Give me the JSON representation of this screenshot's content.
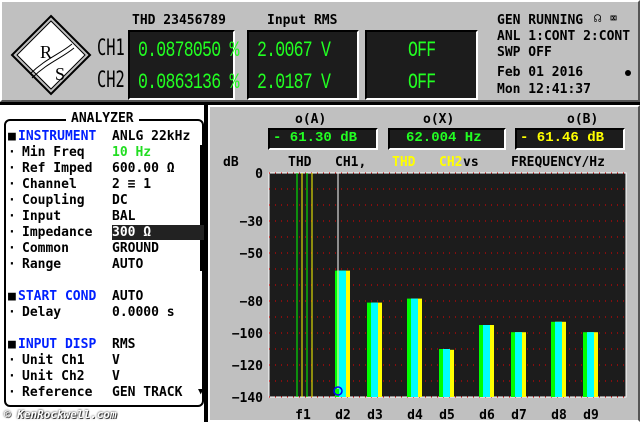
{
  "header": {
    "thd_title": "THD 23456789",
    "rms_title": "Input RMS",
    "ch1_label": "CH1",
    "ch2_label": "CH2",
    "thd_ch1": "0.0878050 %",
    "thd_ch2": "0.0863136 %",
    "rms_ch1": "2.0067  V",
    "rms_ch2": "2.0187  V",
    "third_ch1": "OFF",
    "third_ch2": "OFF",
    "status": {
      "gen": "GEN RUNNING",
      "anl": "ANL 1:CONT 2:CONT",
      "swp": "SWP OFF",
      "date": "Feb 01 2016",
      "time": "Mon 12:41:37"
    },
    "icons": [
      "headphones-muted-icon",
      "speaker-muted-icon",
      "lamp-icon"
    ]
  },
  "analyzer": {
    "title": "ANALYZER",
    "rows": [
      {
        "key": "INSTRUMENT",
        "value": "ANLG  22kHz",
        "section": true
      },
      {
        "key": "Min Freq",
        "value": "10 Hz"
      },
      {
        "key": "Ref Imped",
        "value": "600.00 Ω"
      },
      {
        "key": "Channel",
        "value": "2 ≡ 1"
      },
      {
        "key": "Coupling",
        "value": "DC"
      },
      {
        "key": "Input",
        "value": "BAL"
      },
      {
        "key": "Impedance",
        "value": "300 Ω",
        "selected": true
      },
      {
        "key": "Common",
        "value": "GROUND"
      },
      {
        "key": "Range",
        "value": "AUTO"
      },
      {
        "key": "START COND",
        "value": "AUTO",
        "section": true
      },
      {
        "key": "Delay",
        "value": "0.0000 s"
      },
      {
        "key": "INPUT DISP",
        "value": "RMS",
        "section": true
      },
      {
        "key": "Unit Ch1",
        "value": "V"
      },
      {
        "key": "Unit Ch2",
        "value": "V"
      },
      {
        "key": "Reference",
        "value": "GEN TRACK"
      }
    ],
    "watermark": "© KenRockwell.com"
  },
  "markers": {
    "a_label": "o(A)",
    "a_value": "- 61.30 dB",
    "x_label": "o(X)",
    "x_value": "62.004  Hz",
    "b_label": "o(B)",
    "b_value": "- 61.46 dB"
  },
  "chart_data": {
    "type": "bar",
    "ylabel": "dB",
    "title_parts": [
      "THD",
      "CH1,",
      "THD",
      "CH2",
      "vs",
      "FREQUENCY/Hz"
    ],
    "categories": [
      "f1",
      "d2",
      "d3",
      "d4",
      "d5",
      "d6",
      "d7",
      "d8",
      "d9"
    ],
    "series": [
      {
        "name": "THD CH1",
        "color": "#00ff00",
        "values": [
          0,
          -61,
          -81,
          -78.5,
          -110,
          -95,
          -99.5,
          -93,
          -99.5
        ]
      },
      {
        "name": "THD CH2",
        "color": "#ffff00",
        "values": [
          0,
          -61,
          -81,
          -78.5,
          -110.5,
          -95,
          -99.5,
          -93,
          -99.5
        ]
      }
    ],
    "overlap_color": "#00ffff",
    "ylim": [
      -140,
      0
    ],
    "yticks": [
      0,
      -30,
      -50,
      -80,
      -100,
      -120,
      -140
    ],
    "grid": true
  }
}
